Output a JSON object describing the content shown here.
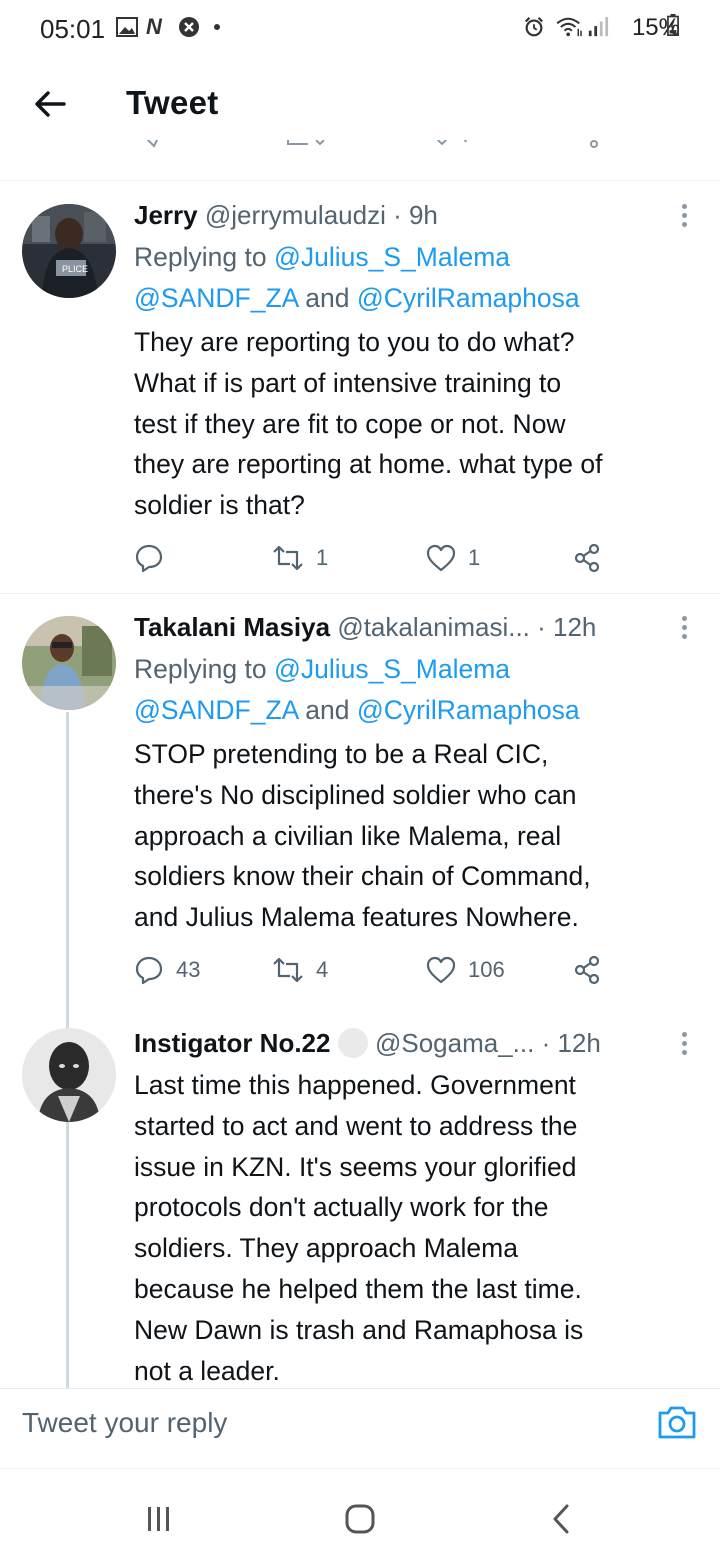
{
  "status_bar": {
    "time": "05:01",
    "battery": "15%"
  },
  "header": {
    "title": "Tweet"
  },
  "tweets": [
    {
      "name": "Jerry",
      "handle": "@jerrymulaudzi",
      "time": "· 9h",
      "replying_prefix": "Replying to ",
      "replying_to": "@Julius_S_Malema",
      "replying_line2_a": "@SANDF_ZA",
      "replying_and": " and ",
      "replying_line2_b": "@CyrilRamaphosa",
      "text": "They are reporting to you to do what?\nWhat if is part of intensive training to\ntest if they are fit to cope or not. Now\nthey are reporting at home. what type of\nsoldier is that?",
      "replies": "",
      "retweets": "1",
      "likes": "1"
    },
    {
      "name": "Takalani Masiya",
      "handle": "@takalanimasi...",
      "time": "· 12h",
      "replying_prefix": "Replying to ",
      "replying_to": "@Julius_S_Malema",
      "replying_line2_a": "@SANDF_ZA",
      "replying_and": " and ",
      "replying_line2_b": "@CyrilRamaphosa",
      "text": "STOP pretending to be a Real CIC,\nthere's No disciplined soldier who can\napproach a civilian like Malema, real\nsoldiers know their chain of Command,\nand Julius Malema features Nowhere.",
      "replies": "43",
      "retweets": "4",
      "likes": "106"
    },
    {
      "name": "Instigator No.22",
      "handle": "@Sogama_...",
      "time": "· 12h",
      "text": "Last time this happened. Government\nstarted to act and went to address the\nissue in KZN. It's seems your glorified\nprotocols don't actually work for the\nsoldiers. They approach Malema\nbecause he helped them the last time.\nNew Dawn is trash and Ramaphosa is\nnot a leader."
    }
  ],
  "reply_bar": {
    "placeholder": "Tweet your reply"
  },
  "icons": {
    "back": "arrow-left-icon",
    "more": "more-vertical-icon",
    "reply": "comment-icon",
    "retweet": "retweet-icon",
    "like": "heart-icon",
    "share": "share-icon",
    "camera": "camera-icon"
  },
  "colors": {
    "link": "#1d9bf0",
    "secondary_text": "#536471",
    "primary_text": "#0f1419"
  }
}
